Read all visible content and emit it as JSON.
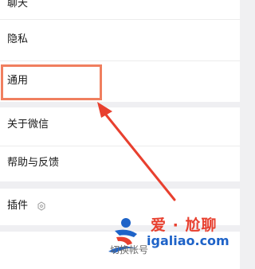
{
  "settings": {
    "items": [
      {
        "label": "聊天"
      },
      {
        "label": "隐私"
      },
      {
        "label": "通用"
      },
      {
        "label": "关于微信"
      },
      {
        "label": "帮助与反馈"
      },
      {
        "label": "插件"
      }
    ]
  },
  "annotation": {
    "highlight_color": "#f07f5f",
    "arrow_color": "#e8402f"
  },
  "watermark": {
    "brand": "爱 · 尬聊",
    "url": "igaliao.com",
    "bottom_text": "切换帐号"
  },
  "icons": {
    "plugin": "hexagon-badge-icon"
  }
}
